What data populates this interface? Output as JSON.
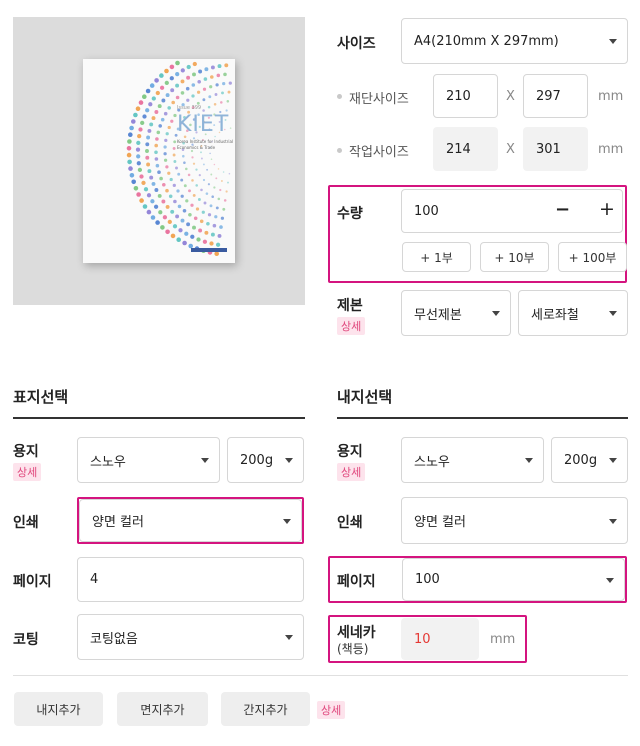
{
  "preview": {
    "brand": "KIET",
    "small_top": "Issue 399",
    "institute_line1": "Korea Institute for Industrial",
    "institute_line2": "Economics & Trade"
  },
  "size": {
    "label": "사이즈",
    "value": "A4(210mm X 297mm)"
  },
  "cut_size": {
    "label": "재단사이즈",
    "w": "210",
    "h": "297",
    "sep": "X",
    "unit": "mm"
  },
  "work_size": {
    "label": "작업사이즈",
    "w": "214",
    "h": "301",
    "sep": "X",
    "unit": "mm"
  },
  "quantity": {
    "label": "수량",
    "value": "100",
    "minus": "−",
    "plus": "+",
    "inc": [
      "+ 1부",
      "+ 10부",
      "+ 100부"
    ]
  },
  "binding": {
    "label": "제본",
    "detail": "상세",
    "type": "무선제본",
    "direction": "세로좌철"
  },
  "cover": {
    "title": "표지선택",
    "paper": {
      "label": "용지",
      "detail": "상세",
      "type": "스노우",
      "weight": "200g"
    },
    "print": {
      "label": "인쇄",
      "value": "양면 컬러"
    },
    "pages": {
      "label": "페이지",
      "value": "4"
    },
    "coating": {
      "label": "코팅",
      "value": "코팅없음"
    }
  },
  "inner": {
    "title": "내지선택",
    "paper": {
      "label": "용지",
      "detail": "상세",
      "type": "스노우",
      "weight": "200g"
    },
    "print": {
      "label": "인쇄",
      "value": "양면 컬러"
    },
    "pages": {
      "label": "페이지",
      "value": "100"
    },
    "spine": {
      "label": "세네카",
      "sublabel": "(책등)",
      "value": "10",
      "unit": "mm"
    }
  },
  "bottom": {
    "buttons": [
      "내지추가",
      "면지추가",
      "간지추가"
    ],
    "detail": "상세"
  },
  "colors": {
    "highlight": "#d4147f",
    "badge_text": "#e0467c",
    "badge_bg": "#fde3ec",
    "spine_value": "#e53935"
  }
}
